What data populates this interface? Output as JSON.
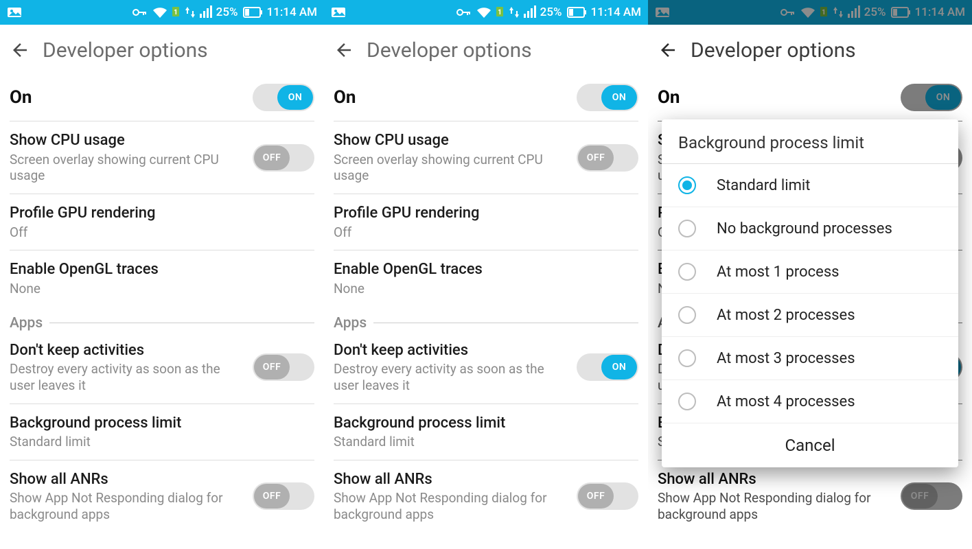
{
  "statusbar": {
    "battery_pct": "25%",
    "time": "11:14 AM"
  },
  "appbar": {
    "title": "Developer options"
  },
  "rows": {
    "master": {
      "title": "On",
      "toggle_label": "ON"
    },
    "cpu": {
      "title": "Show CPU usage",
      "sub": "Screen overlay showing current CPU usage",
      "toggle_label": "OFF"
    },
    "gpu": {
      "title": "Profile GPU rendering",
      "sub": "Off"
    },
    "gl": {
      "title": "Enable OpenGL traces",
      "sub": "None"
    },
    "section_apps": "Apps",
    "dontkeep": {
      "title": "Don't keep activities",
      "sub": "Destroy every activity as soon as the user leaves it",
      "toggle_off": "OFF",
      "toggle_on": "ON"
    },
    "bgproc": {
      "title": "Background process limit",
      "sub": "Standard limit"
    },
    "anr": {
      "title": "Show all ANRs",
      "sub": "Show App Not Responding dialog for background apps",
      "toggle_label": "OFF"
    }
  },
  "dialog": {
    "title": "Background process limit",
    "options": [
      "Standard limit",
      "No background processes",
      "At most 1 process",
      "At most 2 processes",
      "At most 3 processes",
      "At most 4 processes"
    ],
    "selected_index": 0,
    "cancel": "Cancel"
  },
  "screens": [
    {
      "dontkeep_on": false,
      "show_dialog": false
    },
    {
      "dontkeep_on": true,
      "show_dialog": false
    },
    {
      "dontkeep_on": true,
      "show_dialog": true
    }
  ]
}
